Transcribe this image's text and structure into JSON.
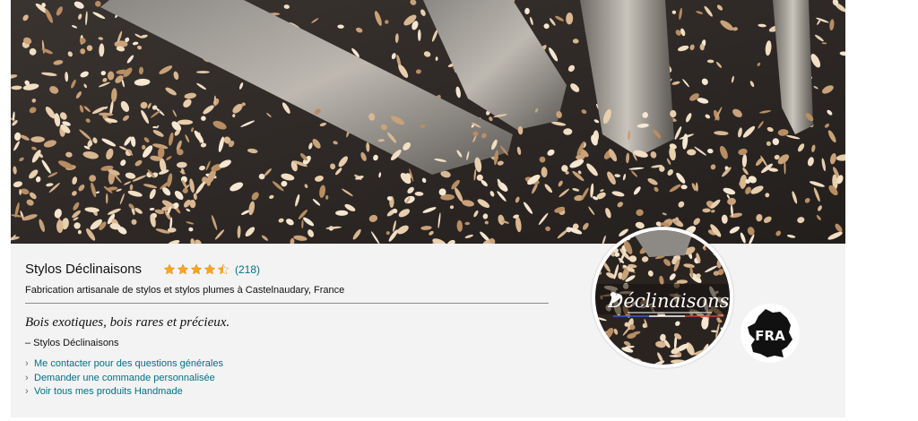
{
  "store": {
    "name": "Stylos Déclinaisons",
    "rating_value": 4.5,
    "rating_count": "(218)",
    "tagline": "Fabrication artisanale de stylos et stylos plumes à Castelnaudary, France",
    "quote": "Bois exotiques, bois rares et précieux.",
    "quote_author": "– Stylos Déclinaisons",
    "links": [
      {
        "label": "Me contacter pour des questions générales"
      },
      {
        "label": "Demander une commande personnalisée"
      },
      {
        "label": "Voir tous mes produits Handmade"
      }
    ],
    "logo_text": "Déclinaisons",
    "country_badge": "FRA"
  },
  "icons": {
    "star": "star-icon",
    "chevron": "chevron-right-icon",
    "country": "france-map-icon"
  },
  "colors": {
    "link": "#007185",
    "star": "#ffa41c",
    "panel_bg": "#f3f3f3"
  }
}
